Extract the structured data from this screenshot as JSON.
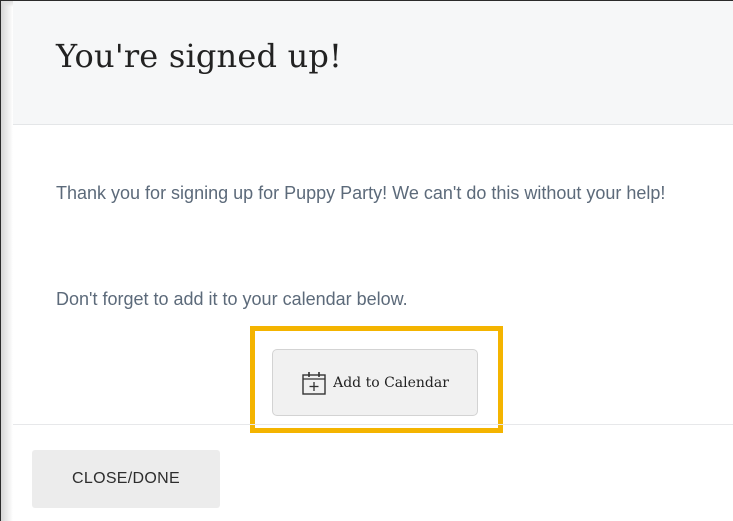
{
  "dialog": {
    "title": "You're signed up!",
    "message": "Thank you for signing up for Puppy Party! We can't do this without your help!",
    "reminder": "Don't forget to add it to your calendar below."
  },
  "calendar_button": {
    "label": "Add to Calendar",
    "icon": "calendar-add-icon"
  },
  "footer": {
    "close_label": "CLOSE/DONE"
  },
  "colors": {
    "highlight": "#f4b400",
    "header_bg": "#f6f7f8",
    "body_text": "#5c6a7a"
  }
}
